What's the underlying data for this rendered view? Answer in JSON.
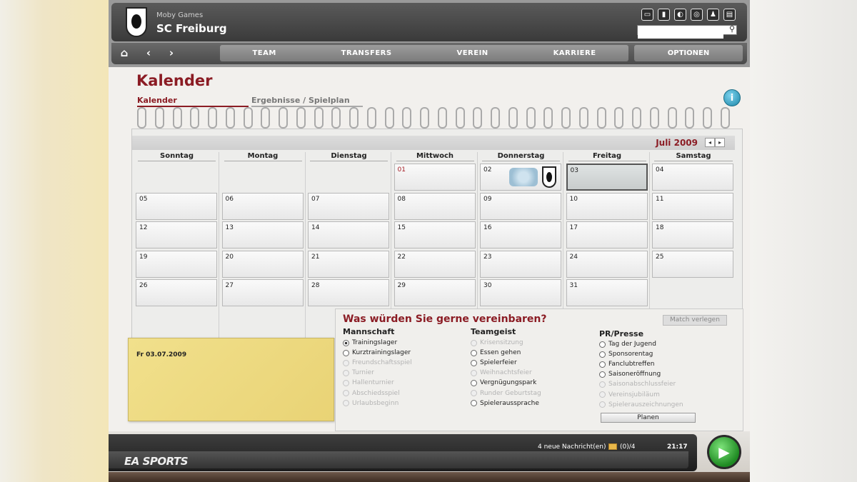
{
  "header": {
    "publisher": "Moby Games",
    "club_name": "SC Freiburg",
    "search": {
      "placeholder": ""
    },
    "menu": [
      "TEAM",
      "TRANSFERS",
      "VEREIN",
      "KARRIERE"
    ],
    "options_label": "OPTIONEN",
    "icons": [
      "screen-icon",
      "stats-icon",
      "moon-icon",
      "globe-icon",
      "people-icon",
      "document-icon"
    ]
  },
  "page": {
    "title": "Kalender",
    "tabs": [
      "Kalender",
      "Ergebnisse / Spielplan"
    ]
  },
  "calendar": {
    "month": "Juli 2009",
    "weekdays": [
      "Sonntag",
      "Montag",
      "Dienstag",
      "Mittwoch",
      "Donnerstag",
      "Freitag",
      "Samstag"
    ],
    "weeks": [
      [
        "",
        "",
        "",
        "01",
        "02",
        "03",
        "04"
      ],
      [
        "05",
        "06",
        "07",
        "08",
        "09",
        "10",
        "11"
      ],
      [
        "12",
        "13",
        "14",
        "15",
        "16",
        "17",
        "18"
      ],
      [
        "19",
        "20",
        "21",
        "22",
        "23",
        "24",
        "25"
      ],
      [
        "26",
        "27",
        "28",
        "29",
        "30",
        "31",
        ""
      ]
    ],
    "today": "01",
    "selected": "03",
    "match_day": "02"
  },
  "note": {
    "date": "Fr 03.07.2009"
  },
  "arrange": {
    "title": "Was würden Sie gerne vereinbaren?",
    "move_match_label": "Match verlegen",
    "plan_label": "Planen",
    "groups": [
      {
        "title": "Mannschaft",
        "options": [
          "Trainingslager",
          "Kurztrainingslager",
          "Freundschaftsspiel",
          "Turnier",
          "Hallenturnier",
          "Abschiedsspiel",
          "Urlaubsbeginn"
        ]
      },
      {
        "title": "Teamgeist",
        "options": [
          "Krisensitzung",
          "Essen gehen",
          "Spielerfeier",
          "Weihnachtsfeier",
          "Vergnügungspark",
          "Runder Geburtstag",
          "Spieleraussprache"
        ]
      },
      {
        "title": "PR/Presse",
        "options": [
          "Tag der Jugend",
          "Sponsorentag",
          "Fanclubtreffen",
          "Saisoneröffnung",
          "Saisonabschlussfeier",
          "Vereinsjubiläum",
          "Spielerauszeichnungen"
        ]
      }
    ]
  },
  "footer": {
    "brand": "EA SPORTS",
    "messages": "4 neue Nachricht(en)",
    "mail_count": "(0)/4",
    "time": "21:17"
  }
}
